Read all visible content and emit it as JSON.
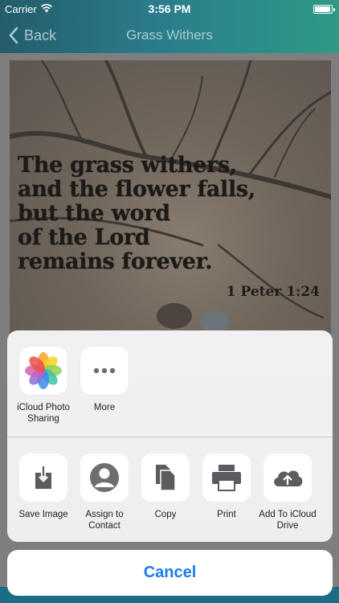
{
  "status_bar": {
    "carrier": "Carrier",
    "time": "3:56 PM",
    "battery_level": 0.95
  },
  "nav": {
    "back_label": "Back",
    "title": "Grass Withers"
  },
  "quote": {
    "lines": [
      "The grass withers,",
      "and the flower falls,",
      "but the word",
      "of the Lord",
      "remains forever."
    ],
    "reference": "1 Peter 1:24"
  },
  "share_sheet": {
    "apps": [
      {
        "label": "iCloud Photo Sharing",
        "icon": "photos-icon"
      },
      {
        "label": "More",
        "icon": "more-icon"
      }
    ],
    "actions": [
      {
        "label": "Save Image",
        "icon": "save-image-icon"
      },
      {
        "label": "Assign to Contact",
        "icon": "contact-icon"
      },
      {
        "label": "Copy",
        "icon": "copy-icon"
      },
      {
        "label": "Print",
        "icon": "print-icon"
      },
      {
        "label": "Add To iCloud Drive",
        "icon": "icloud-drive-icon"
      }
    ],
    "cancel_label": "Cancel"
  },
  "colors": {
    "accent": "#1a7cf0",
    "nav_gradient_start": "#245c6a",
    "nav_gradient_end": "#2f9a86"
  }
}
